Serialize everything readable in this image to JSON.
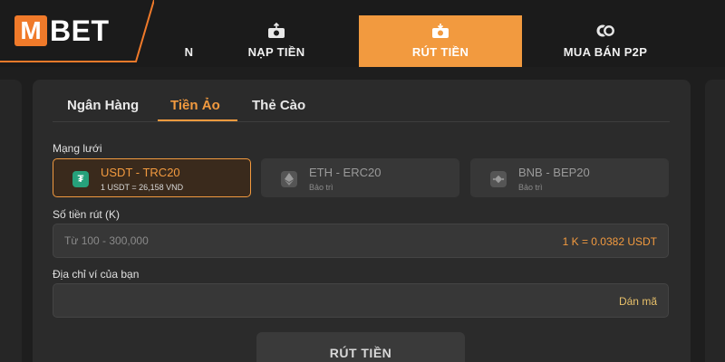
{
  "brand": {
    "logo_letter": "M",
    "logo_text": "BET"
  },
  "nav": {
    "items": [
      {
        "label": "N",
        "icon": "bank-icon"
      },
      {
        "label": "NẠP TIỀN",
        "icon": "deposit-icon"
      },
      {
        "label": "RÚT TIỀN",
        "icon": "withdraw-icon",
        "active": true
      },
      {
        "label": "MUA BÁN P2P",
        "icon": "coins-icon"
      }
    ]
  },
  "subtabs": [
    {
      "label": "Ngân Hàng"
    },
    {
      "label": "Tiền Ảo",
      "active": true
    },
    {
      "label": "Thẻ Cào"
    }
  ],
  "network": {
    "label": "Mạng lưới",
    "options": [
      {
        "name": "USDT - TRC20",
        "sub": "1 USDT = 26,158 VND",
        "icon": "tether-icon",
        "selected": true
      },
      {
        "name": "ETH - ERC20",
        "sub": "Bảo trì",
        "icon": "ethereum-icon"
      },
      {
        "name": "BNB - BEP20",
        "sub": "Bảo trì",
        "icon": "bnb-icon"
      }
    ]
  },
  "amount": {
    "label": "Số tiền rút (K)",
    "placeholder": "Từ 100 - 300,000",
    "rate": "1 K = 0.0382 USDT"
  },
  "wallet": {
    "label": "Địa chỉ ví của bạn",
    "placeholder": "",
    "paste_label": "Dán mã"
  },
  "submit_label": "RÚT TIỀN",
  "colors": {
    "accent": "#f29a3f",
    "brand": "#f07a2a",
    "paste": "#e8c06a",
    "background": "#1e1e1e",
    "panel": "#2b2b2b"
  }
}
